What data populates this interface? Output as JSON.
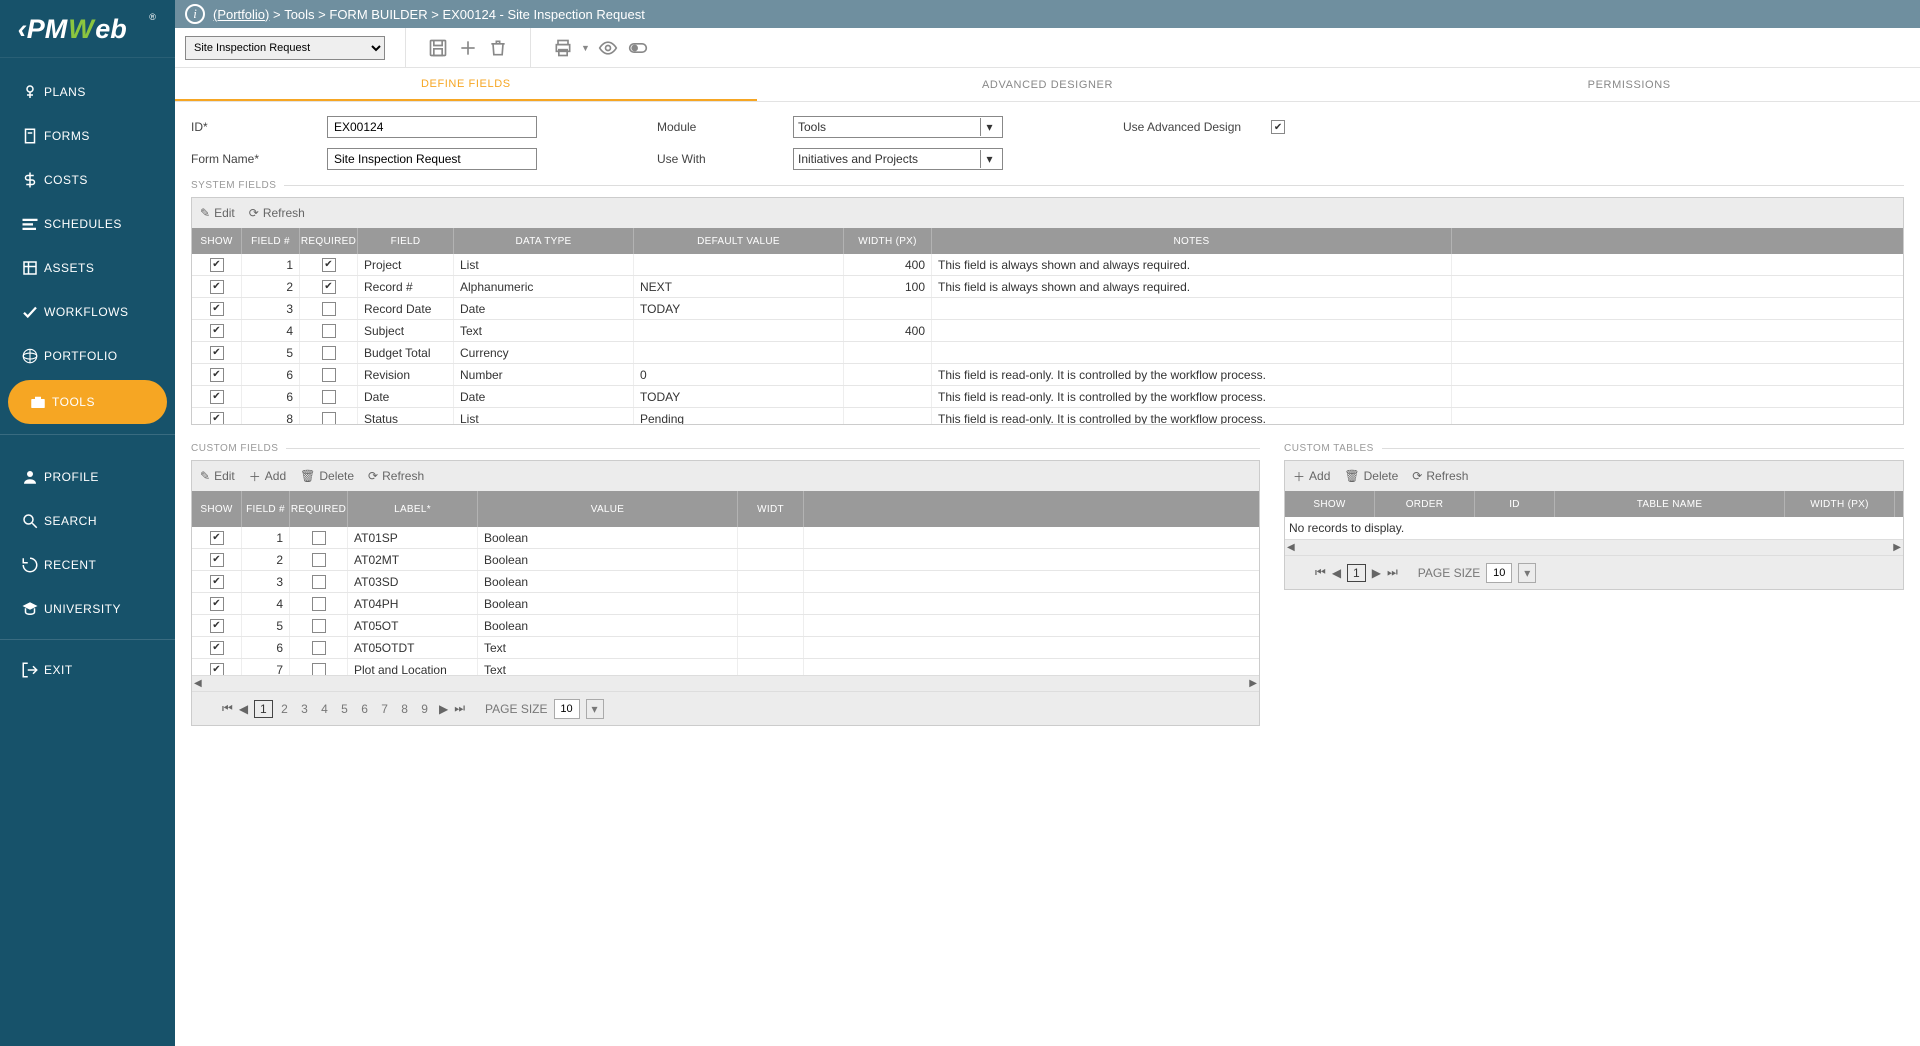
{
  "logo_text": "PMWeb",
  "breadcrumb": {
    "portfolio": "(Portfolio)",
    "sep": " > ",
    "tools": "Tools",
    "fb": "FORM BUILDER",
    "id": "EX00124",
    "name": "Site Inspection Request"
  },
  "record_selector": "Site Inspection Request",
  "sideNav": {
    "primary": [
      "PLANS",
      "FORMS",
      "COSTS",
      "SCHEDULES",
      "ASSETS",
      "WORKFLOWS",
      "PORTFOLIO",
      "TOOLS"
    ],
    "secondary": [
      "PROFILE",
      "SEARCH",
      "RECENT",
      "UNIVERSITY"
    ],
    "exit": "EXIT"
  },
  "tabs": [
    "DEFINE FIELDS",
    "ADVANCED DESIGNER",
    "PERMISSIONS"
  ],
  "form": {
    "id_label": "ID*",
    "id_value": "EX00124",
    "name_label": "Form Name*",
    "name_value": "Site Inspection Request",
    "module_label": "Module",
    "module_value": "Tools",
    "usewith_label": "Use With",
    "usewith_value": "Initiatives and Projects",
    "advanced_label": "Use Advanced Design",
    "advanced_checked": true
  },
  "sections": {
    "system": "SYSTEM FIELDS",
    "custom": "CUSTOM FIELDS",
    "tables": "CUSTOM TABLES"
  },
  "gridTools": {
    "edit": "Edit",
    "refresh": "Refresh",
    "add": "Add",
    "delete": "Delete"
  },
  "systemCols": [
    "SHOW",
    "FIELD #",
    "REQUIRED",
    "FIELD",
    "DATA TYPE",
    "DEFAULT VALUE",
    "WIDTH (PX)",
    "NOTES"
  ],
  "systemRows": [
    {
      "show": true,
      "num": "1",
      "req": true,
      "field": "Project",
      "type": "List",
      "def": "",
      "width": "400",
      "notes": "This field is always shown and always required."
    },
    {
      "show": true,
      "num": "2",
      "req": true,
      "field": "Record #",
      "type": "Alphanumeric",
      "def": "NEXT",
      "width": "100",
      "notes": "This field is always shown and always required."
    },
    {
      "show": true,
      "num": "3",
      "req": false,
      "field": "Record Date",
      "type": "Date",
      "def": "TODAY",
      "width": "",
      "notes": ""
    },
    {
      "show": true,
      "num": "4",
      "req": false,
      "field": "Subject",
      "type": "Text",
      "def": "",
      "width": "400",
      "notes": ""
    },
    {
      "show": true,
      "num": "5",
      "req": false,
      "field": "Budget Total",
      "type": "Currency",
      "def": "",
      "width": "",
      "notes": ""
    },
    {
      "show": true,
      "num": "6",
      "req": false,
      "field": "Revision",
      "type": "Number",
      "def": "0",
      "width": "",
      "notes": "This field is read-only. It is controlled by the workflow process."
    },
    {
      "show": true,
      "num": "6",
      "req": false,
      "field": "Date",
      "type": "Date",
      "def": "TODAY",
      "width": "",
      "notes": "This field is read-only. It is controlled by the workflow process."
    },
    {
      "show": true,
      "num": "8",
      "req": false,
      "field": "Status",
      "type": "List",
      "def": "Pending",
      "width": "",
      "notes": "This field is read-only. It is controlled by the workflow process."
    }
  ],
  "customCols": [
    "SHOW",
    "FIELD #",
    "REQUIRED",
    "LABEL*",
    "VALUE",
    "WIDT"
  ],
  "customRows": [
    {
      "show": true,
      "num": "1",
      "req": false,
      "label": "AT01SP",
      "value": "Boolean"
    },
    {
      "show": true,
      "num": "2",
      "req": false,
      "label": "AT02MT",
      "value": "Boolean"
    },
    {
      "show": true,
      "num": "3",
      "req": false,
      "label": "AT03SD",
      "value": "Boolean"
    },
    {
      "show": true,
      "num": "4",
      "req": false,
      "label": "AT04PH",
      "value": "Boolean"
    },
    {
      "show": true,
      "num": "5",
      "req": false,
      "label": "AT05OT",
      "value": "Boolean"
    },
    {
      "show": true,
      "num": "6",
      "req": false,
      "label": "AT05OTDT",
      "value": "Text"
    },
    {
      "show": true,
      "num": "7",
      "req": false,
      "label": "Plot and Location",
      "value": "Text"
    }
  ],
  "customPager": {
    "pages": [
      "1",
      "2",
      "3",
      "4",
      "5",
      "6",
      "7",
      "8",
      "9"
    ],
    "pagesize_label": "PAGE SIZE",
    "pagesize": "10"
  },
  "tableCols": [
    "SHOW",
    "ORDER",
    "ID",
    "TABLE NAME",
    "WIDTH (PX)"
  ],
  "tableEmpty": "No records to display.",
  "tablePager": {
    "current": "1",
    "pagesize_label": "PAGE SIZE",
    "pagesize": "10"
  }
}
